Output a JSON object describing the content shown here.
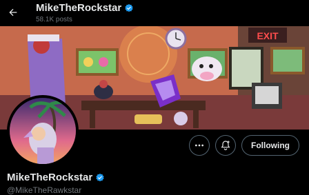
{
  "header": {
    "display_name": "MikeTheRockstar",
    "post_count": "58.1K posts"
  },
  "banner": {
    "exit_sign_text": "EXIT"
  },
  "actions": {
    "follow_label": "Following"
  },
  "profile": {
    "display_name": "MikeTheRockstar",
    "handle": "@MikeTheRawkstar"
  },
  "colors": {
    "background": "#000000",
    "text_primary": "#e7e9ea",
    "text_secondary": "#71767b",
    "verified_blue": "#1d9bf0",
    "button_border": "#536471"
  },
  "icons": [
    "back-arrow-icon",
    "verified-badge-icon",
    "more-icon",
    "notification-bell-plus-icon"
  ]
}
